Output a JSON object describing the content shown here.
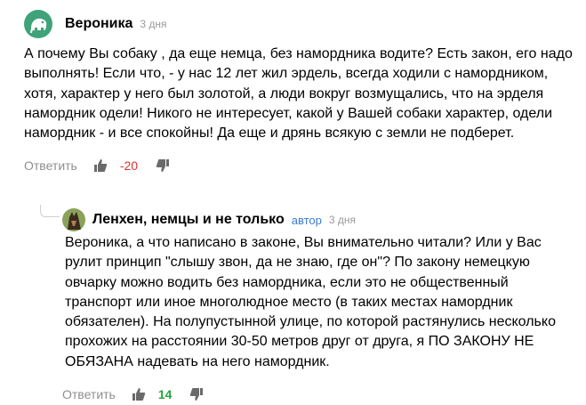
{
  "comments": [
    {
      "author": "Вероника",
      "time": "3 дня",
      "text": "А почему Вы собаку , да еще немца, без намордника водите? Есть закон, его надо выполнять! Если что, - у нас 12 лет жил эрдель, всегда ходили с намордником, хотя, характер у него был золотой, а люди вокруг возмущались, что на эрделя намордник одели! Никого не интересует, какой у Вашей собаки характер, одели намордник - и все спокойны! Да еще и дрянь всякую с земли не подберет.",
      "reply_label": "Ответить",
      "score": "-20",
      "colors": {
        "avatar_bg": "#3fa37a",
        "score": "#e0312b"
      }
    },
    {
      "author": "Ленхен, немцы и не только",
      "badge": "автор",
      "time": "3 дня",
      "text": "Вероника, а что написано в законе, Вы внимательно читали? Или у Вас рулит принцип \"слышу звон, да не знаю, где он\"? По закону немецкую овчарку можно водить без намордника, если это не общественный транспорт или иное многолюдное место (в таких местах намордник обязателен). На полупустынной улице, по которой растянулись несколько прохожих на расстоянии 30-50 метров друг от друга, я ПО ЗАКОНУ НЕ ОБЯЗАНА надевать на него намордник.",
      "reply_label": "Ответить",
      "score": "14",
      "colors": {
        "badge": "#3b7cd1",
        "score": "#27a53a"
      }
    }
  ],
  "icons": [
    "elephant-avatar-icon",
    "dog-avatar-icon",
    "thumbs-up-icon",
    "thumbs-down-icon"
  ]
}
